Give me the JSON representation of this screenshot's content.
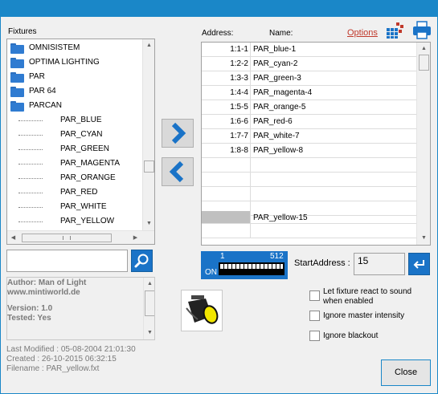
{
  "fixtures": {
    "label": "Fixtures",
    "folders": [
      "OMNISISTEM",
      "OPTIMA LIGHTING",
      "PAR",
      "PAR 64",
      "PARCAN"
    ],
    "leaves": [
      "PAR_BLUE",
      "PAR_CYAN",
      "PAR_GREEN",
      "PAR_MAGENTA",
      "PAR_ORANGE",
      "PAR_RED",
      "PAR_WHITE",
      "PAR_YELLOW"
    ]
  },
  "search": {
    "value": "",
    "icon": "magnifier-icon"
  },
  "info": {
    "author": "Author: Man of Light",
    "website": "www.mintiworld.de",
    "version": "Version: 1.0",
    "tested": "Tested: Yes"
  },
  "meta": {
    "last_modified": "Last Modified : 05-08-2004 21:01:30",
    "created": "Created : 26-10-2015 06:32:15",
    "filename": "Filename : PAR_yellow.fxt"
  },
  "table": {
    "address_header": "Address:",
    "name_header": "Name:",
    "options_link": "Options",
    "rows": [
      {
        "address": "1:1-1",
        "name": "PAR_blue-1"
      },
      {
        "address": "1:2-2",
        "name": "PAR_cyan-2"
      },
      {
        "address": "1:3-3",
        "name": "PAR_green-3"
      },
      {
        "address": "1:4-4",
        "name": "PAR_magenta-4"
      },
      {
        "address": "1:5-5",
        "name": "PAR_orange-5"
      },
      {
        "address": "1:6-6",
        "name": "PAR_red-6"
      },
      {
        "address": "1:7-7",
        "name": "PAR_white-7"
      },
      {
        "address": "1:8-8",
        "name": "PAR_yellow-8"
      },
      {
        "address": "",
        "name": ""
      },
      {
        "address": "",
        "name": ""
      },
      {
        "address": "",
        "name": ""
      },
      {
        "address": "",
        "name": ""
      },
      {
        "address": "",
        "name": "PAR_yellow-15"
      },
      {
        "address": "",
        "name": ""
      }
    ]
  },
  "dmx": {
    "start": "1",
    "end": "512",
    "on": "ON"
  },
  "start_address": {
    "label": "StartAddress :",
    "value": "15"
  },
  "options": [
    {
      "label": "Let fixture react to sound",
      "label2": "when enabled",
      "checked": false
    },
    {
      "label": "Ignore master intensity",
      "checked": false
    },
    {
      "label": "Ignore blackout",
      "checked": false
    }
  ],
  "close_label": "Close",
  "colors": {
    "accent": "#1a73c7",
    "titlebar": "#1a87c8",
    "options_link": "#c0392b"
  }
}
